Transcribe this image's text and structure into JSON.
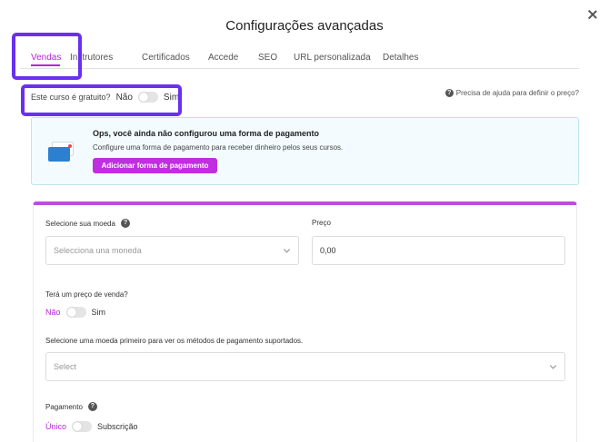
{
  "dialog": {
    "title": "Configurações avançadas"
  },
  "tabs": [
    {
      "label": "Vendas"
    },
    {
      "label": "Instrutores"
    },
    {
      "label": "Certificados"
    },
    {
      "label": "Accede"
    },
    {
      "label": "SEO"
    },
    {
      "label": "URL personalizada"
    },
    {
      "label": "Detalhes"
    }
  ],
  "free_course": {
    "label": "Este curso é gratuito?",
    "no": "Não",
    "yes": "Sim"
  },
  "help_link": "Precisa de ajuda para definir o preço?",
  "alert": {
    "title": "Ops, você ainda não configurou uma forma de pagamento",
    "text": "Configure uma forma de pagamento para receber dinheiro pelos seus cursos.",
    "button": "Adicionar forma de pagamento"
  },
  "currency": {
    "label": "Selecione sua moeda",
    "placeholder": "Selecciona una moneda"
  },
  "price": {
    "label": "Preço",
    "value": "0,00"
  },
  "sale_price": {
    "label": "Terá um preço de venda?",
    "no": "Não",
    "yes": "Sim"
  },
  "payment_methods": {
    "label": "Selecione uma moeda primeiro para ver os métodos de pagamento suportados.",
    "placeholder": "Select"
  },
  "payment": {
    "label": "Pagamento",
    "single": "Único",
    "subscription": "Subscrição"
  },
  "colors": {
    "accent": "#b427d8",
    "highlight": "#6a2ff0"
  }
}
